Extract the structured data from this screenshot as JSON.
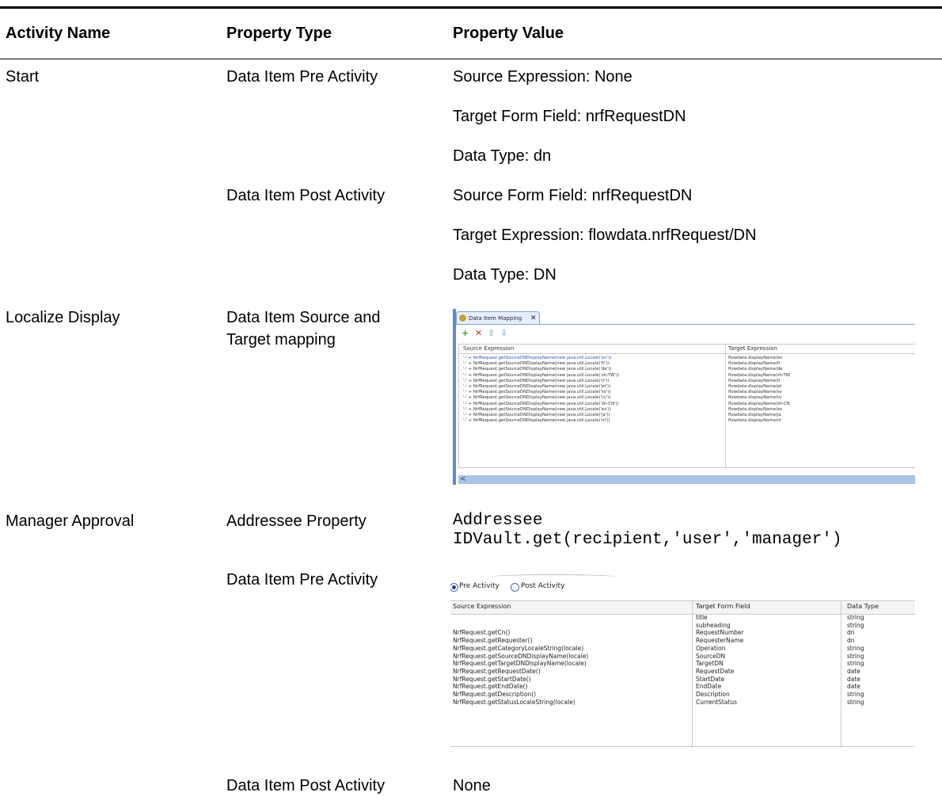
{
  "table": {
    "headers": [
      "Activity Name",
      "Property Type",
      "Property Value"
    ],
    "rows": [
      {
        "activity": "Start",
        "type": "Data Item Pre Activity",
        "values": [
          "Source Expression: None",
          "Target Form Field: nrfRequestDN",
          "Data Type: dn"
        ]
      },
      {
        "type": "Data Item Post Activity",
        "values": [
          "Source Form Field: nrfRequestDN",
          "Target Expression: flowdata.nrfRequest/DN",
          "Data Type: DN"
        ]
      },
      {
        "activity": "Localize Display",
        "type": [
          "Data Item Source and",
          "Target mapping"
        ]
      },
      {
        "activity": "Manager Approval",
        "type": "Addressee Property",
        "values": [
          "Addressee",
          "IDVault.get(recipient,'user','manager')"
        ]
      },
      {
        "type": "Data Item Pre Activity"
      },
      {
        "type": "Data Item Post Activity",
        "values": [
          "None"
        ]
      }
    ]
  },
  "mapping_screenshot": {
    "tab_label": "Data Item Mapping",
    "close_glyph": "✕",
    "toolbar": [
      "+",
      "✕",
      "⇧",
      "⇩"
    ],
    "columns": [
      "Source Expression",
      "Target Expression"
    ],
    "rows": [
      [
        "'-' + NrfRequest.getSourceDNDisplayName(new java.util.Locale('en'))",
        "flowdata.displayName/en"
      ],
      [
        "'-' + NrfRequest.getSourceDNDisplayName(new java.util.Locale('fr'))",
        "flowdata.displayName/fr"
      ],
      [
        "'-' + NrfRequest.getSourceDNDisplayName(new java.util.Locale('de'))",
        "flowdata.displayName/de"
      ],
      [
        "'-' + NrfRequest.getSourceDNDisplayName(new java.util.Locale('zh-TW'))",
        "flowdata.displayName/zh-TW"
      ],
      [
        "'-' + NrfRequest.getSourceDNDisplayName(new java.util.Locale('it'))",
        "flowdata.displayName/it"
      ],
      [
        "'-' + NrfRequest.getSourceDNDisplayName(new java.util.Locale('pt'))",
        "flowdata.displayName/pt"
      ],
      [
        "'-' + NrfRequest.getSourceDNDisplayName(new java.util.Locale('sv'))",
        "flowdata.displayName/sv"
      ],
      [
        "'-' + NrfRequest.getSourceDNDisplayName(new java.util.Locale('ru'))",
        "flowdata.displayName/ru"
      ],
      [
        "'-' + NrfRequest.getSourceDNDisplayName(new java.util.Locale('zh-CN'))",
        "flowdata.displayName/zh-CN"
      ],
      [
        "'-' + NrfRequest.getSourceDNDisplayName(new java.util.Locale('es'))",
        "flowdata.displayName/es"
      ],
      [
        "'-' + NrfRequest.getSourceDNDisplayName(new java.util.Locale('ja'))",
        "flowdata.displayName/ja"
      ],
      [
        "'-' + NrfRequest.getSourceDNDisplayName(new java.util.Locale('nl'))",
        "flowdata.displayName/nl"
      ]
    ],
    "scroll_arrow": "<"
  },
  "pre_activity_screenshot": {
    "radio_pre": "Pre Activity",
    "radio_post": "Post Activity",
    "columns": [
      "Source Expression",
      "Target Form Field",
      "Data Type"
    ],
    "rows": [
      [
        "",
        "title",
        "string"
      ],
      [
        "",
        "subheading",
        "string"
      ],
      [
        "NrfRequest.getCn()",
        "RequestNumber",
        "dn"
      ],
      [
        "NrfRequest.getRequester()",
        "RequesterName",
        "dn"
      ],
      [
        "NrfRequest.getCategoryLocaleString(locale)",
        "Operation",
        "string"
      ],
      [
        "NrfRequest.getSourceDNDisplayName(locale)",
        "SourceDN",
        "string"
      ],
      [
        "NrfRequest.getTargetDNDisplayName(locale)",
        "TargetDN",
        "string"
      ],
      [
        "NrfRequest.getRequestDate()",
        "RequestDate",
        "date"
      ],
      [
        "NrfRequest.getStartDate()",
        "StartDate",
        "date"
      ],
      [
        "NrfRequest.getEndDate()",
        "EndDate",
        "date"
      ],
      [
        "NrfRequest.getDescription()",
        "Description",
        "string"
      ],
      [
        "NrfRequest.getStatusLocaleString(locale)",
        "CurrentStatus",
        "string"
      ]
    ]
  },
  "colors": {
    "text": "#000000",
    "accent_blue": "#5b8ad1",
    "add_green": "#2e9e2e",
    "delete_red": "#d23030"
  }
}
